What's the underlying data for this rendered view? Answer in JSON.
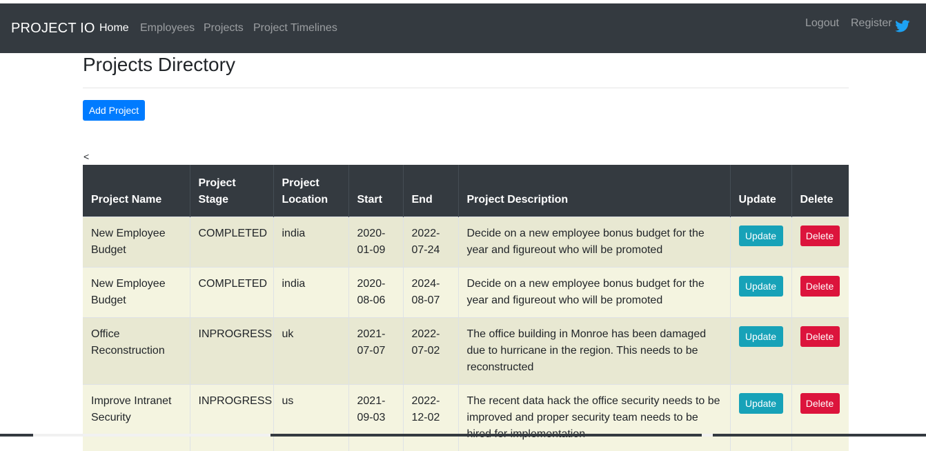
{
  "navbar": {
    "brand": "PROJECT IO",
    "links": [
      "Home",
      "Employees",
      "Projects",
      "Project Timelines"
    ],
    "right_links": [
      "Logout",
      "Register"
    ],
    "social_icon": "twitter-icon"
  },
  "page": {
    "title": "Projects Directory",
    "add_button": "Add Project",
    "pager_prev": "<"
  },
  "table": {
    "headers": [
      "Project Name",
      "Project Stage",
      "Project Location",
      "Start",
      "End",
      "Project Description",
      "Update",
      "Delete"
    ],
    "rows": [
      {
        "name": "New Employee Budget",
        "stage": "COMPLETED",
        "location": "india",
        "start": "2020-01-09",
        "end": "2022-07-24",
        "description": "Decide on a new employee bonus budget for the year and figureout who will be promoted",
        "update": "Update",
        "delete": "Delete"
      },
      {
        "name": "New Employee Budget",
        "stage": "COMPLETED",
        "location": "india",
        "start": "2020-08-06",
        "end": "2024-08-07",
        "description": "Decide on a new employee bonus budget for the year and figureout who will be promoted",
        "update": "Update",
        "delete": "Delete"
      },
      {
        "name": "Office Reconstruction",
        "stage": "INPROGRESS",
        "location": "uk",
        "start": "2021-07-07",
        "end": "2022-07-02",
        "description": "The office building in Monroe has been damaged due to hurricane in the region. This needs to be reconstructed",
        "update": "Update",
        "delete": "Delete"
      },
      {
        "name": "Improve Intranet Security",
        "stage": "INPROGRESS",
        "location": "us",
        "start": "2021-09-03",
        "end": "2022-12-02",
        "description": "The recent data hack the office security needs to be improved and proper security team needs to be hired for implementation",
        "update": "Update",
        "delete": "Delete"
      }
    ]
  },
  "colors": {
    "navbar": "#343a40",
    "primary": "#007bff",
    "info": "#17a2b8",
    "danger": "#dc143c",
    "row_odd": "#e8e8d2",
    "row_even": "#f4f4e0"
  }
}
